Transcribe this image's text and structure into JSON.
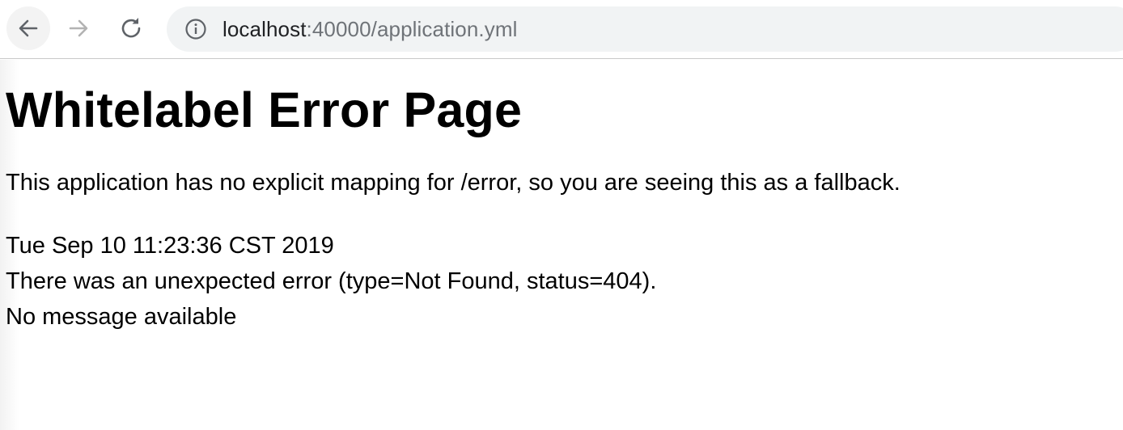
{
  "browser": {
    "url_host": "localhost",
    "url_rest": ":40000/application.yml",
    "icons": {
      "back": "arrow-left-icon",
      "forward": "arrow-right-icon",
      "reload": "reload-icon",
      "site_info": "info-icon"
    }
  },
  "page": {
    "title": "Whitelabel Error Page",
    "explanation": "This application has no explicit mapping for /error, so you are seeing this as a fallback.",
    "timestamp": "Tue Sep 10 11:23:36 CST 2019",
    "error_line": "There was an unexpected error (type=Not Found, status=404).",
    "message": "No message available"
  }
}
